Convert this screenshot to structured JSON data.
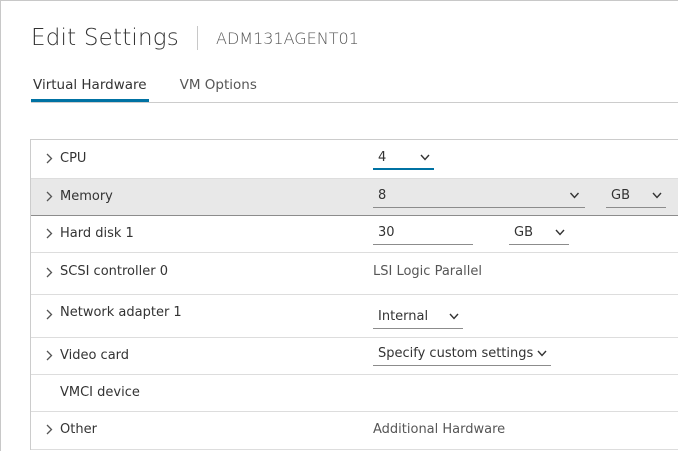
{
  "header": {
    "title": "Edit Settings",
    "vm_name": "ADM131AGENT01"
  },
  "tabs": [
    {
      "label": "Virtual Hardware",
      "active": true
    },
    {
      "label": "VM Options",
      "active": false
    }
  ],
  "rows": {
    "cpu": {
      "label": "CPU",
      "value": "4"
    },
    "memory": {
      "label": "Memory",
      "value": "8",
      "unit": "GB"
    },
    "hard_disk": {
      "label": "Hard disk 1",
      "value": "30",
      "unit": "GB"
    },
    "scsi": {
      "label": "SCSI controller 0",
      "value": "LSI Logic Parallel"
    },
    "network": {
      "label": "Network adapter 1",
      "value": "Internal"
    },
    "video": {
      "label": "Video card",
      "value": "Specify custom settings"
    },
    "vmci": {
      "label": "VMCI device"
    },
    "other": {
      "label": "Other",
      "value": "Additional Hardware"
    }
  },
  "colors": {
    "accent": "#0072a3",
    "selected_row": "#e8e8e8",
    "border": "#cccccc"
  },
  "icons": {
    "row_expander": "chevron-right-icon",
    "select_arrow": "chevron-down-icon"
  }
}
